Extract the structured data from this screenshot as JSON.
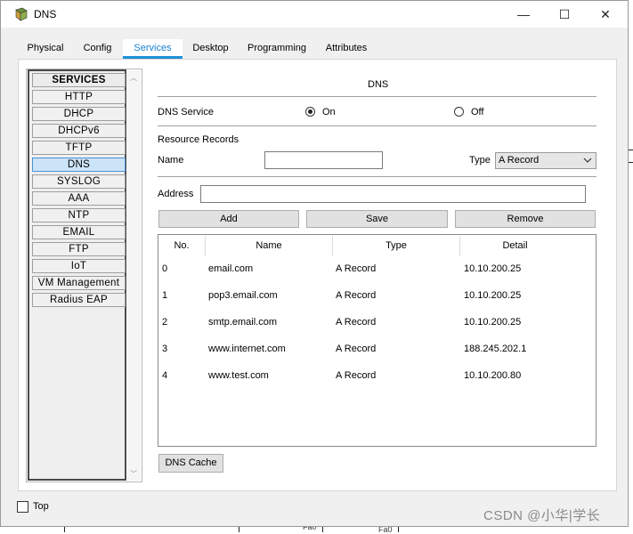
{
  "window": {
    "title": "DNS",
    "minimize_glyph": "—",
    "maximize_glyph": "☐",
    "close_glyph": "✕"
  },
  "tabs": [
    {
      "label": "Physical",
      "active": false
    },
    {
      "label": "Config",
      "active": false
    },
    {
      "label": "Services",
      "active": true
    },
    {
      "label": "Desktop",
      "active": false
    },
    {
      "label": "Programming",
      "active": false
    },
    {
      "label": "Attributes",
      "active": false
    }
  ],
  "services": {
    "header": "SERVICES",
    "selected": "DNS",
    "items": [
      "HTTP",
      "DHCP",
      "DHCPv6",
      "TFTP",
      "DNS",
      "SYSLOG",
      "AAA",
      "NTP",
      "EMAIL",
      "FTP",
      "IoT",
      "VM Management",
      "Radius EAP"
    ]
  },
  "dns": {
    "heading": "DNS",
    "service_label": "DNS Service",
    "on_label": "On",
    "off_label": "Off",
    "service_state": "On",
    "resource_records_label": "Resource Records",
    "name_label": "Name",
    "name_value": "",
    "type_label": "Type",
    "type_value": "A Record",
    "address_label": "Address",
    "address_value": "",
    "add_button": "Add",
    "save_button": "Save",
    "remove_button": "Remove",
    "cache_button": "DNS Cache"
  },
  "records_table": {
    "columns": [
      "No.",
      "Name",
      "Type",
      "Detail"
    ],
    "rows": [
      [
        "0",
        "email.com",
        "A Record",
        "10.10.200.25"
      ],
      [
        "1",
        "pop3.email.com",
        "A Record",
        "10.10.200.25"
      ],
      [
        "2",
        "smtp.email.com",
        "A Record",
        "10.10.200.25"
      ],
      [
        "3",
        "www.internet.com",
        "A Record",
        "188.245.202.1"
      ],
      [
        "4",
        "www.test.com",
        "A Record",
        "10.10.200.80"
      ]
    ]
  },
  "footer": {
    "top_label": "Top",
    "top_checked": false
  },
  "watermark": "CSDN @小华|学长",
  "background_fragments": [
    "F",
    "0/",
    "T",
    "Fa0",
    "Fa0"
  ],
  "colors": {
    "active_tab": "#1a7fcf",
    "selected_service": "#cce4f7",
    "window_bg": "#f0f0f0"
  }
}
